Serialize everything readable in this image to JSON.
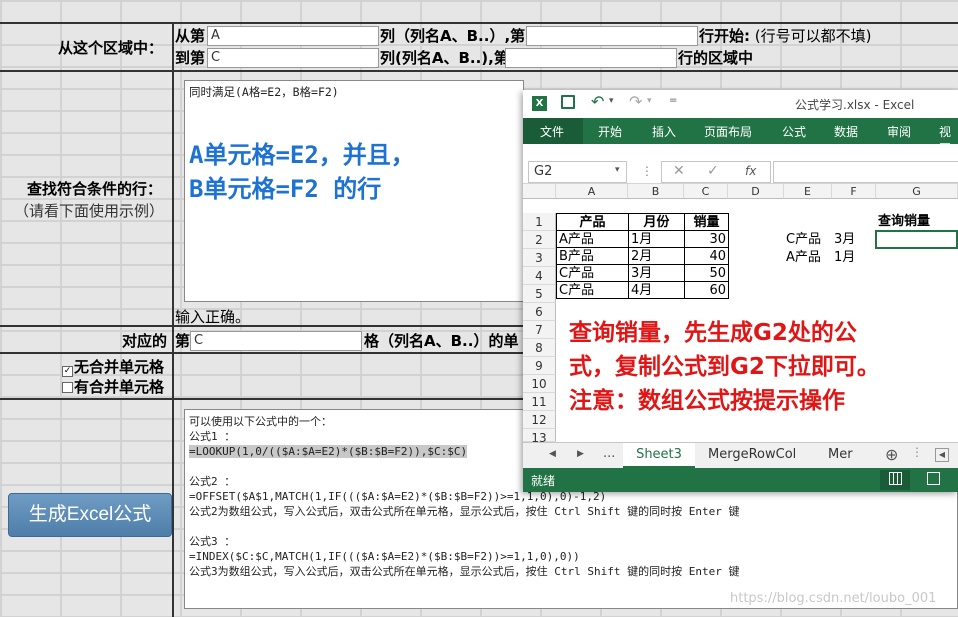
{
  "form": {
    "row1": {
      "label": "从这个区域中：",
      "from_prefix": "从第",
      "from_col_value": "A",
      "col_note": "列（列名A、B..）,第",
      "row_start_note": "行开始:",
      "row_optional": "(行号可以都不填)",
      "to_prefix": "到第",
      "to_col_value": "C",
      "col_note2": "列(列名A、B..),第",
      "row_end_note": "行的区域中"
    },
    "row2": {
      "label": "查找符合条件的行：",
      "sublabel": "（请看下面使用示例）",
      "textarea_first_line": "同时满足(A格=E2，B格=F2)",
      "big_text_line1": "A单元格=E2，并且，",
      "big_text_line2": "B单元格=F2 的行",
      "hint": "输入正确。"
    },
    "row3": {
      "label": "对应的",
      "prefix": "第",
      "col_value": "C",
      "note": "格（列名A、B..）的单"
    },
    "row4": {
      "opt1_label": "无合并单元格",
      "opt2_label": "有合并单元格"
    },
    "generate_button": "生成Excel公式",
    "output_lines": [
      "可以使用以下公式中的一个：",
      "公式1 ：",
      "=LOOKUP(1,0/(($A:$A=E2)*($B:$B=F2)),$C:$C)",
      "",
      "公式2 ：",
      "=OFFSET($A$1,MATCH(1,IF((($A:$A=E2)*($B:$B=F2))>=1,1,0),0)-1,2)",
      "公式2为数组公式，写入公式后，双击公式所在单元格，显示公式后，按住 Ctrl Shift 键的同时按 Enter 键",
      "",
      "公式3 ：",
      "=INDEX($C:$C,MATCH(1,IF((($A:$A=E2)*($B:$B=F2))>=1,1,0),0))",
      "公式3为数组公式，写入公式后，双击公式所在单元格，显示公式后，按住 Ctrl Shift 键的同时按 Enter 键"
    ]
  },
  "excel": {
    "title": "公式学习.xlsx - Excel",
    "tabs": [
      "文件",
      "开始",
      "插入",
      "页面布局",
      "公式",
      "数据",
      "审阅",
      "视图"
    ],
    "name_box": "G2",
    "fx": "fx",
    "columns": [
      "A",
      "B",
      "C",
      "D",
      "E",
      "F",
      "G"
    ],
    "row_numbers": [
      "1",
      "2",
      "3",
      "4",
      "5",
      "6",
      "7",
      "8",
      "9",
      "10",
      "11",
      "12",
      "13"
    ],
    "header_row": [
      "产品",
      "月份",
      "销量"
    ],
    "rows": [
      [
        "A产品",
        "1月",
        "30"
      ],
      [
        "B产品",
        "2月",
        "40"
      ],
      [
        "C产品",
        "3月",
        "50"
      ],
      [
        "C产品",
        "4月",
        "60"
      ]
    ],
    "query_rows": [
      [
        "C产品",
        "3月"
      ],
      [
        "A产品",
        "1月"
      ]
    ],
    "g1_label": "查询销量",
    "note_lines": [
      "查询销量，先生成G2处的公",
      "式，复制公式到G2下拉即可。",
      "注意：数组公式按提示操作"
    ],
    "sheet_tabs": [
      "Sheet3",
      "MergeRowCol",
      "Mer"
    ],
    "sheet_nav_more": "...",
    "status": "就绪"
  },
  "watermark": "https://blog.csdn.net/loubo_001",
  "colors": {
    "excel_green": "#217346",
    "note_red": "#e01515",
    "big_text_blue": "#1e73d2"
  }
}
